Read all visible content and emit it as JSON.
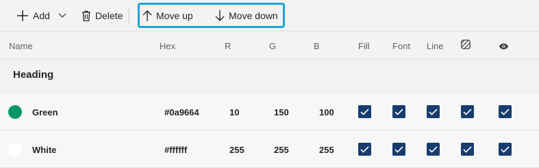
{
  "toolbar": {
    "add_label": "Add",
    "delete_label": "Delete",
    "move_up_label": "Move up",
    "move_down_label": "Move down",
    "highlight_color": "#1aa6d6"
  },
  "columns": {
    "name": "Name",
    "hex": "Hex",
    "r": "R",
    "g": "G",
    "b": "B",
    "fill": "Fill",
    "font": "Font",
    "line": "Line",
    "pattern_icon": "pattern-icon",
    "visibility_icon": "eye-icon"
  },
  "group": {
    "label": "Heading"
  },
  "rows": [
    {
      "name": "Green",
      "hex": "#0a9664",
      "r": "10",
      "g": "150",
      "b": "100",
      "swatch": "#0a9664",
      "fill": true,
      "font": true,
      "line": true,
      "pattern": true,
      "visible": true
    },
    {
      "name": "White",
      "hex": "#ffffff",
      "r": "255",
      "g": "255",
      "b": "255",
      "swatch": "#ffffff",
      "fill": true,
      "font": true,
      "line": true,
      "pattern": true,
      "visible": true
    }
  ],
  "colors": {
    "checkbox": "#173d6e",
    "background": "#f3f3f3"
  }
}
